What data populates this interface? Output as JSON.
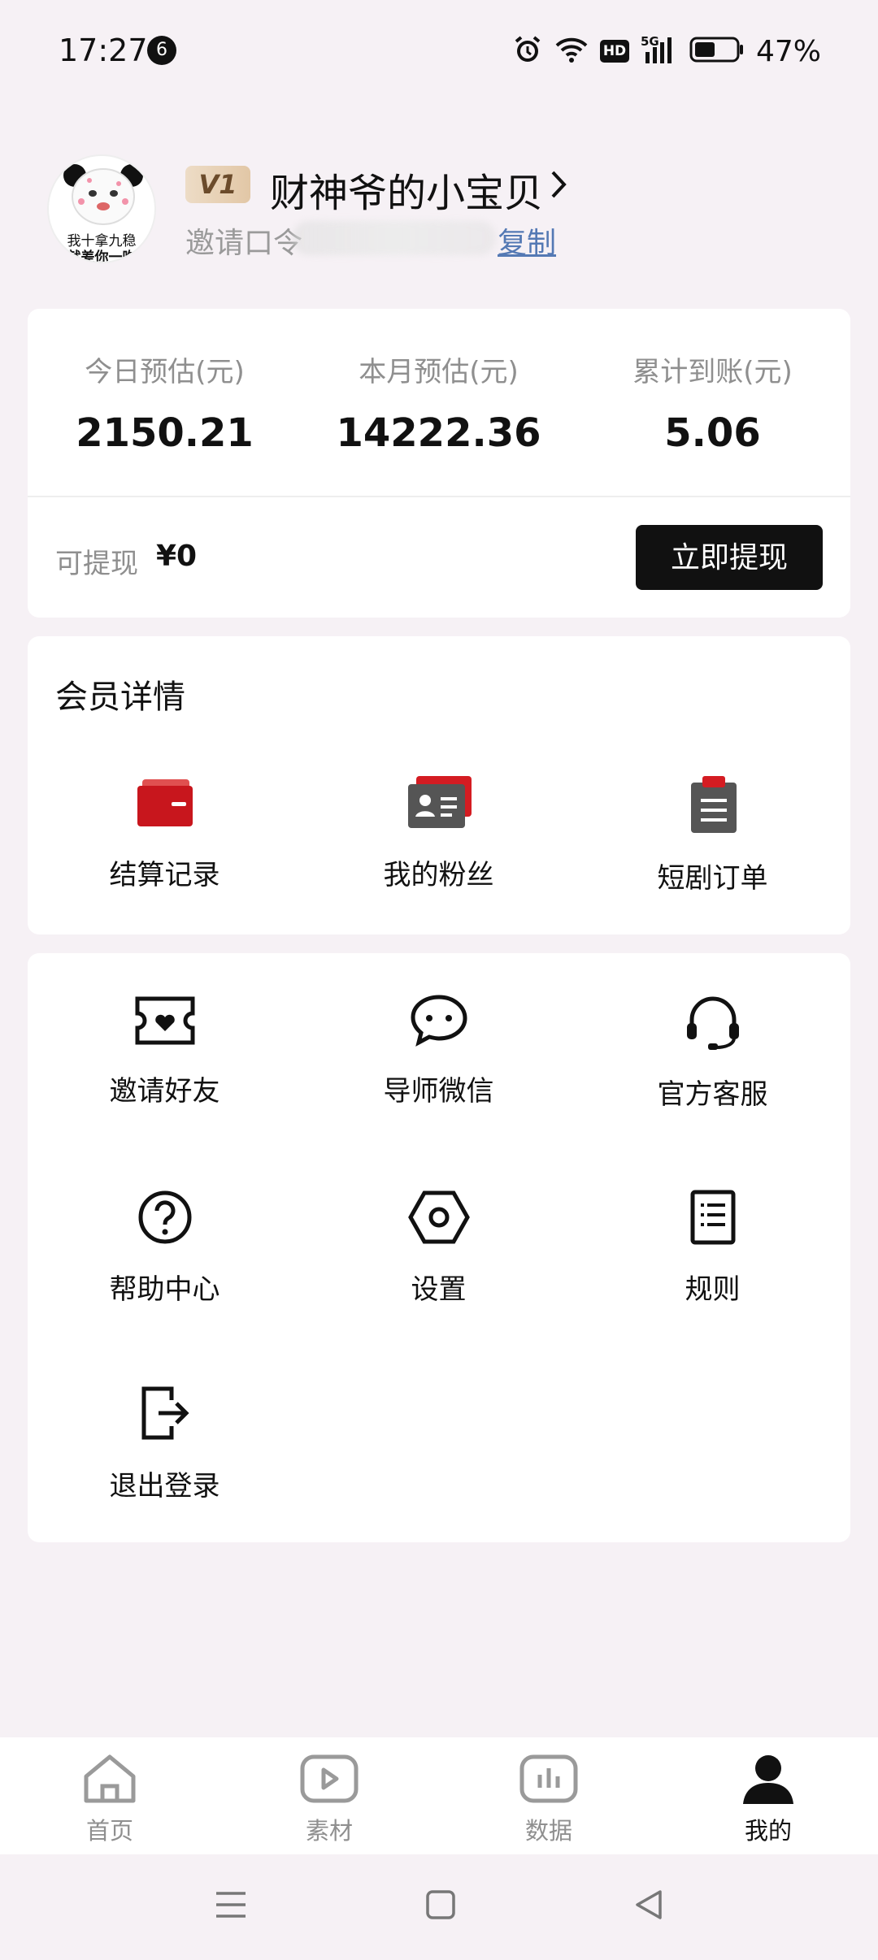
{
  "status_bar": {
    "time": "17:27",
    "notification_count": "6",
    "network": "5G",
    "hd_label": "HD",
    "battery": "47%"
  },
  "profile": {
    "avatar_caption_line1": "我十拿九稳",
    "avatar_caption_line2": "就差你一吻",
    "vip_level": "V1",
    "nickname": "财神爷的小宝贝",
    "invite_label": "邀请口令",
    "copy_label": "复制"
  },
  "earnings": {
    "stats": [
      {
        "label": "今日预估(元)",
        "value": "2150.21"
      },
      {
        "label": "本月预估(元)",
        "value": "14222.36"
      },
      {
        "label": "累计到账(元)",
        "value": "5.06"
      }
    ],
    "withdrawable_label": "可提现",
    "withdrawable_value": "¥0",
    "withdraw_button": "立即提现"
  },
  "member": {
    "title": "会员详情",
    "items": [
      {
        "label": "结算记录",
        "icon": "wallet-icon"
      },
      {
        "label": "我的粉丝",
        "icon": "id-card-icon"
      },
      {
        "label": "短剧订单",
        "icon": "clipboard-icon"
      }
    ]
  },
  "tools": {
    "items": [
      {
        "label": "邀请好友",
        "icon": "ticket-heart-icon"
      },
      {
        "label": "导师微信",
        "icon": "chat-icon"
      },
      {
        "label": "官方客服",
        "icon": "headset-icon"
      },
      {
        "label": "帮助中心",
        "icon": "help-icon"
      },
      {
        "label": "设置",
        "icon": "settings-icon"
      },
      {
        "label": "规则",
        "icon": "rules-icon"
      },
      {
        "label": "退出登录",
        "icon": "logout-icon"
      }
    ]
  },
  "bottom_nav": {
    "items": [
      {
        "label": "首页",
        "icon": "home-icon"
      },
      {
        "label": "素材",
        "icon": "play-icon"
      },
      {
        "label": "数据",
        "icon": "chart-icon"
      },
      {
        "label": "我的",
        "icon": "person-icon",
        "active": true
      }
    ]
  },
  "colors": {
    "accent_red": "#c8161d",
    "dark": "#111111",
    "link_blue": "#5479b4",
    "background": "#f6f1f5"
  }
}
